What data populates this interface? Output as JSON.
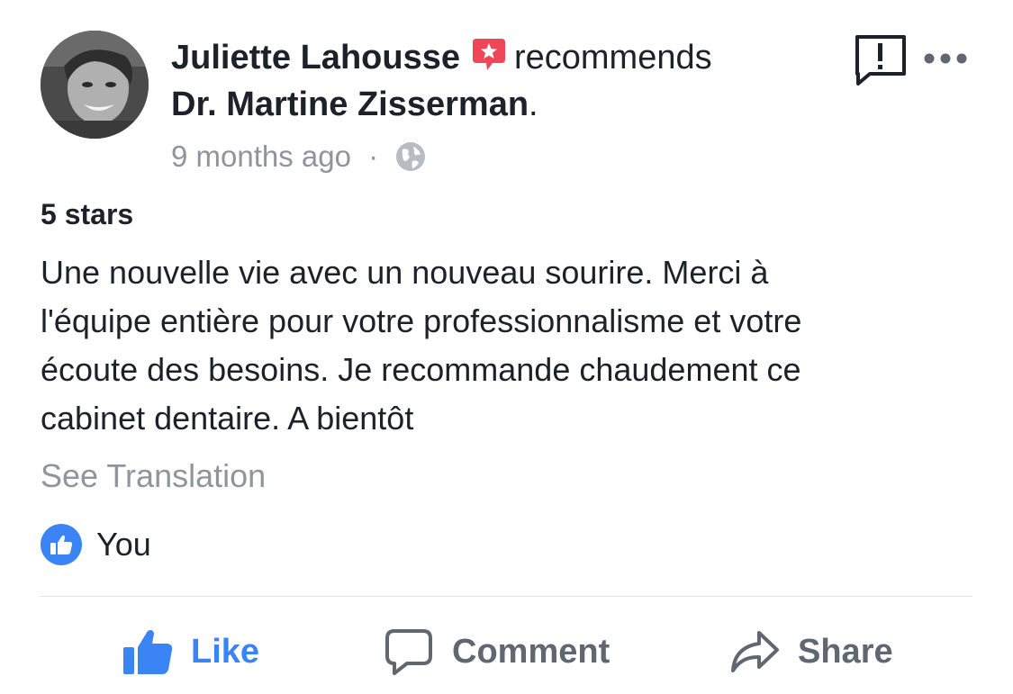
{
  "post": {
    "author": "Juliette Lahousse",
    "action_text": "recommends",
    "page_name": "Dr. Martine Zisserman",
    "page_name_suffix": ".",
    "timestamp": "9 months ago",
    "separator": "·",
    "privacy_icon": "globe-icon"
  },
  "review": {
    "rating": "5 stars",
    "lines": [
      "Une nouvelle vie avec un nouveau sourire. Merci à",
      "l'équipe entière pour votre professionnalisme et votre",
      "écoute des besoins. Je recommande chaudement ce",
      "cabinet dentaire. A bientôt"
    ],
    "see_translation": "See Translation"
  },
  "reactions": {
    "icon": "thumbs-up-icon",
    "text": "You"
  },
  "actions": {
    "like": "Like",
    "comment": "Comment",
    "share": "Share"
  },
  "colors": {
    "accent": "#3b84f5",
    "badge": "#f0465a",
    "muted": "#90949c",
    "text": "#1d2129"
  }
}
